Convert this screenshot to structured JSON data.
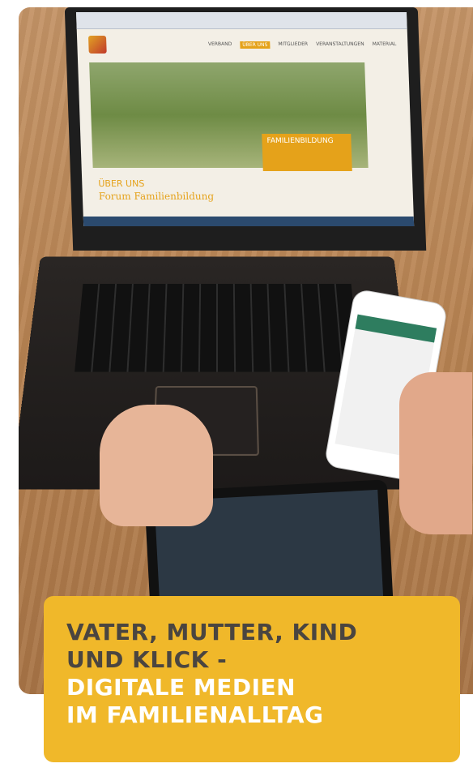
{
  "photo": {
    "description_icons": [
      "laptop",
      "smartphone",
      "tablet",
      "hands"
    ],
    "laptop_screen": {
      "page_title": "ÜBER UNS",
      "page_subtitle": "Forum Familienbildung",
      "hero_tag": "FAMILIENBILDUNG",
      "nav_items": [
        "VERBAND",
        "ÜBER UNS",
        "MITGLIEDER",
        "VERANSTALTUNGEN",
        "MATERIAL"
      ],
      "accent_color": "#e5a21a"
    }
  },
  "title_banner": {
    "line1": "VATER, MUTTER, KIND",
    "line2": "UND KLICK -",
    "line3": "DIGITALE MEDIEN",
    "line4": "IM FAMILIENALLTAG",
    "background_color": "#f0b82a",
    "dark_text_color": "#4a4540",
    "light_text_color": "#ffffff"
  }
}
